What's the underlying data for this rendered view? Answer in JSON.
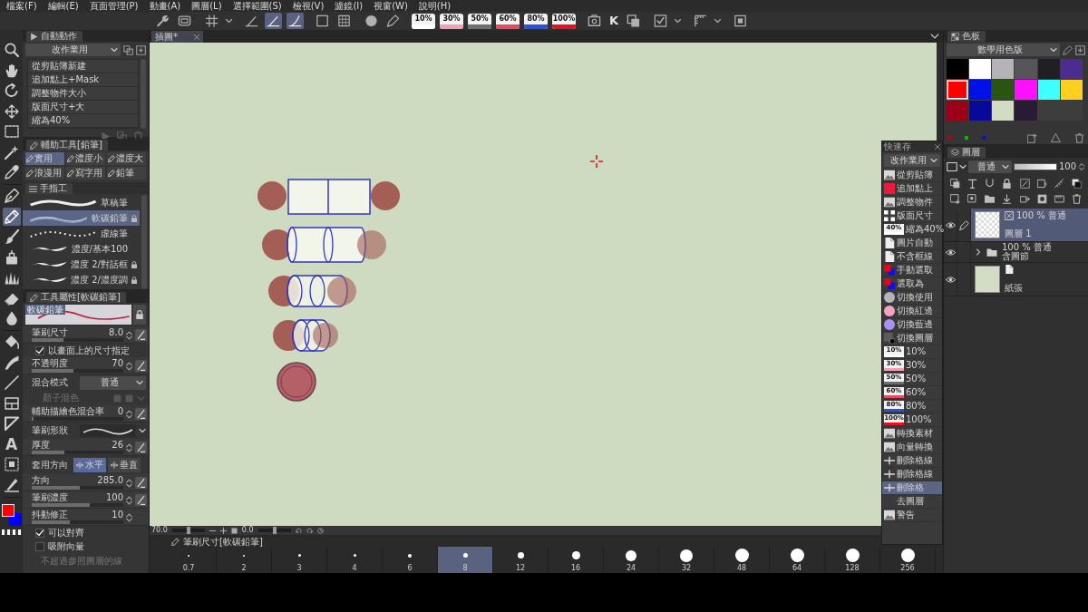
{
  "menu": [
    "檔案(F)",
    "編輯(E)",
    "頁面管理(P)",
    "動畫(A)",
    "圖層(L)",
    "選擇範圍(S)",
    "檢視(V)",
    "濾鏡(I)",
    "視窗(W)",
    "說明(H)"
  ],
  "toolbar": [
    [
      {
        "kind": "wrench",
        "selected": false
      },
      {
        "kind": "screen",
        "selected": false
      }
    ],
    [
      {
        "kind": "grid",
        "selected": false
      },
      {
        "kind": "caret",
        "selected": false
      }
    ],
    [
      {
        "kind": "ruler",
        "selected": false
      },
      {
        "kind": "ruler",
        "selected": true
      },
      {
        "kind": "curve",
        "selected": true
      }
    ],
    [
      {
        "kind": "box",
        "selected": false
      },
      {
        "kind": "gridbox",
        "selected": false
      }
    ],
    [
      {
        "kind": "dot",
        "selected": false
      },
      {
        "kind": "pen",
        "selected": false
      }
    ],
    [
      {
        "kind": "badge",
        "label": "10%",
        "color": "#ffffff",
        "selected": false
      },
      {
        "kind": "badge",
        "label": "30%",
        "color": "#f4a0b0",
        "selected": false
      },
      {
        "kind": "badge",
        "label": "50%",
        "color": "#6e6e6e",
        "selected": false
      },
      {
        "kind": "badge",
        "label": "60%",
        "color": "#e84860",
        "selected": false
      },
      {
        "kind": "badge",
        "label": "80%",
        "color": "#2850e8",
        "selected": false
      },
      {
        "kind": "badge",
        "label": "100%",
        "color": "#e81020",
        "selected": false
      }
    ],
    [
      {
        "kind": "image",
        "selected": false
      },
      {
        "kind": "letter",
        "label": "K",
        "selected": false
      },
      {
        "kind": "copy",
        "selected": false
      }
    ],
    [
      {
        "kind": "check",
        "selected": false
      },
      {
        "kind": "caret",
        "selected": false
      }
    ],
    [
      {
        "kind": "rulerset",
        "selected": false
      },
      {
        "kind": "caret",
        "selected": false
      }
    ],
    [
      {
        "kind": "square",
        "selected": false
      }
    ]
  ],
  "tools": [
    [
      {
        "kind": "zoom",
        "selected": false
      },
      {
        "kind": "hand",
        "selected": false
      },
      {
        "kind": "rotate",
        "selected": false
      },
      {
        "kind": "move",
        "selected": false
      },
      {
        "kind": "select",
        "selected": false
      },
      {
        "kind": "wand",
        "selected": false
      },
      {
        "kind": "eyedropper",
        "selected": false
      }
    ],
    [
      {
        "kind": "pen",
        "selected": false
      },
      {
        "kind": "pencil",
        "selected": true
      },
      {
        "kind": "brush",
        "selected": false
      },
      {
        "kind": "airbrush",
        "selected": false
      },
      {
        "kind": "decoration",
        "selected": false
      },
      {
        "kind": "eraser",
        "selected": false
      },
      {
        "kind": "blend",
        "selected": false
      }
    ],
    [
      {
        "kind": "fill",
        "selected": false
      },
      {
        "kind": "gradient",
        "selected": false
      },
      {
        "kind": "line",
        "selected": false
      },
      {
        "kind": "frame",
        "selected": false
      },
      {
        "kind": "ruler",
        "selected": false
      },
      {
        "kind": "text",
        "label": "A",
        "selected": false
      },
      {
        "kind": "balloon",
        "selected": false
      },
      {
        "kind": "correction",
        "selected": false
      }
    ]
  ],
  "colors": {
    "main": {
      "color": "#ff0000"
    },
    "sub": {
      "color": "#0000ff"
    }
  },
  "auto_action": {
    "tab": "自動動作",
    "set": "改作業用",
    "items": [
      "從剪貼簿新建",
      "追加點上+Mask",
      "調整物件大小",
      "版面尺寸+大",
      "縮為40%"
    ]
  },
  "sub_tool": {
    "title": "輔助工具[鉛筆]",
    "groups": [
      {
        "label": "實用",
        "selected": true
      },
      {
        "label": "濃度小",
        "selected": false
      },
      {
        "label": "濃度大",
        "selected": false
      },
      {
        "label": "浪漫用",
        "selected": false
      },
      {
        "label": "寫字用",
        "selected": false
      },
      {
        "label": "鉛筆",
        "selected": false
      }
    ],
    "tab": "手指工",
    "brushes": [
      {
        "kind": "rough",
        "label": "草稿筆",
        "selected": false,
        "locked": false
      },
      {
        "kind": "soft",
        "label": "軟碳鉛筆",
        "selected": true,
        "locked": true
      },
      {
        "kind": "dotted",
        "label": "虛線筆",
        "selected": false,
        "locked": false
      },
      {
        "kind": "stroke",
        "label": "濃度/基本100",
        "selected": false,
        "locked": false
      },
      {
        "kind": "stroke",
        "label": "濃度 2/對話框",
        "selected": false,
        "locked": true
      },
      {
        "kind": "stroke",
        "label": "濃度 2/濃度調",
        "selected": false,
        "locked": true
      }
    ]
  },
  "tool_property": {
    "title": "工具屬性[軟碳鉛筆]",
    "preview_label": "軟碳鉛筆",
    "rows": [
      {
        "kind": "slider",
        "label": "筆刷尺寸",
        "value": "8.0",
        "level": 0.35,
        "pressure": true
      },
      {
        "kind": "check",
        "label": "以畫面上的尺寸指定",
        "checked": true
      },
      {
        "kind": "slider",
        "label": "不透明度",
        "value": "70",
        "level": 0.46,
        "pressure": true
      },
      {
        "kind": "select",
        "label": "混合模式",
        "value": "普通"
      },
      {
        "kind": "disabled",
        "label": "顏子混色"
      },
      {
        "kind": "slider",
        "label": "輔助描繪色混合率",
        "value": "0",
        "level": 0,
        "pressure": true
      },
      {
        "kind": "shape",
        "label": "筆刷形狀"
      },
      {
        "kind": "slider",
        "label": "厚度",
        "value": "26",
        "level": 0.36,
        "pressure": true
      },
      {
        "kind": "toggle",
        "label": "套用方向",
        "options": [
          {
            "label": "水平",
            "selected": true
          },
          {
            "label": "垂直",
            "selected": false
          }
        ]
      },
      {
        "kind": "slider",
        "label": "方向",
        "value": "285.0",
        "level": 0.52,
        "pressure": true
      },
      {
        "kind": "slider",
        "label": "筆刷濃度",
        "value": "100",
        "level": 0.63,
        "pressure": true
      },
      {
        "kind": "slider",
        "label": "抖動修正",
        "value": "10",
        "level": 0.42,
        "pressure": false
      },
      {
        "kind": "check",
        "label": "可以對齊",
        "checked": true
      },
      {
        "kind": "check",
        "label": "吸附向量",
        "checked": false
      },
      {
        "kind": "note",
        "label": "不超過參照圖層的線"
      }
    ]
  },
  "canvas": {
    "tab": "插圖*",
    "zoom": {
      "value": "70.0",
      "level": 0.5
    },
    "angle": {
      "value": "0.0",
      "level": 0.5
    }
  },
  "quick_access": {
    "title": "快速存",
    "set": "改作業用",
    "items": [
      {
        "kind": "image",
        "label": "從剪貼簿",
        "selected": false
      },
      {
        "kind": "color",
        "label": "追加點上",
        "color": "#ee1a3a",
        "selected": false
      },
      {
        "kind": "image",
        "label": "調整物件",
        "selected": false
      },
      {
        "kind": "fit",
        "label": "版面尺寸",
        "selected": false
      },
      {
        "kind": "badge",
        "badge": "40%",
        "label": "縮為40%",
        "color": "#ffffff",
        "selected": false
      },
      {
        "kind": "page",
        "label": "圖片自動",
        "selected": false
      },
      {
        "kind": "page",
        "label": "不含框線",
        "selected": false
      },
      {
        "kind": "pair",
        "label": "手動選取",
        "selected": false
      },
      {
        "kind": "pair",
        "label": "選取為",
        "selected": false
      },
      {
        "kind": "circle",
        "label": "切換使用",
        "color": "#b4b4bc",
        "selected": false
      },
      {
        "kind": "circle",
        "label": "切換紅邊",
        "color": "#f4a4bc",
        "selected": false
      },
      {
        "kind": "circle",
        "label": "切換藍邊",
        "color": "#a890f4",
        "selected": false
      },
      {
        "kind": "layercolor",
        "label": "切換圖層",
        "selected": false
      },
      {
        "kind": "badge",
        "badge": "10%",
        "label": "10%",
        "color": "#ffffff",
        "selected": false
      },
      {
        "kind": "badge",
        "badge": "30%",
        "label": "30%",
        "color": "#f4a0b0",
        "selected": false
      },
      {
        "kind": "badge",
        "badge": "50%",
        "label": "50%",
        "color": "#6e6e6e",
        "selected": false
      },
      {
        "kind": "badge",
        "badge": "60%",
        "label": "60%",
        "color": "#e84860",
        "selected": false
      },
      {
        "kind": "badge",
        "badge": "80%",
        "label": "80%",
        "color": "#2850e8",
        "selected": false
      },
      {
        "kind": "badge",
        "badge": "100%",
        "label": "100%",
        "color": "#e81020",
        "selected": false
      },
      {
        "kind": "image",
        "label": "轉換素材",
        "selected": false
      },
      {
        "kind": "image",
        "label": "向量轉換",
        "selected": false
      },
      {
        "kind": "rule",
        "label": "刪除格線",
        "selected": false
      },
      {
        "kind": "rule",
        "label": "刪除格線",
        "selected": false
      },
      {
        "kind": "rule",
        "label": "刪除格",
        "selected": true
      },
      {
        "kind": "none",
        "label": "去圖層",
        "selected": false
      },
      {
        "kind": "image",
        "label": "警告",
        "selected": false
      }
    ]
  },
  "brush_size": {
    "title": "筆刷尺寸[軟碳鉛筆]",
    "sizes": [
      {
        "label": "0.7",
        "selected": false
      },
      {
        "label": "2",
        "selected": false
      },
      {
        "label": "3",
        "selected": false
      },
      {
        "label": "4",
        "selected": false
      },
      {
        "label": "6",
        "selected": false
      },
      {
        "label": "8",
        "selected": true
      },
      {
        "label": "12",
        "selected": false
      },
      {
        "label": "16",
        "selected": false
      },
      {
        "label": "24",
        "selected": false
      },
      {
        "label": "32",
        "selected": false
      },
      {
        "label": "48",
        "selected": false
      },
      {
        "label": "64",
        "selected": false
      },
      {
        "label": "128",
        "selected": false
      },
      {
        "label": "256",
        "selected": false
      }
    ]
  },
  "color_set": {
    "tab": "色板",
    "set": "數學用色版",
    "swatches": [
      {
        "color": "#000000",
        "selected": false
      },
      {
        "color": "#ffffff",
        "selected": false
      },
      {
        "color": "#b4b4b8",
        "selected": false
      },
      {
        "color": "#56565a",
        "selected": false
      },
      {
        "color": "#202024",
        "selected": false
      },
      {
        "color": "#4c2c8c",
        "selected": false
      },
      {
        "color": "#ff0000",
        "selected": true
      },
      {
        "color": "#0010e8",
        "selected": false
      },
      {
        "color": "#2a5412",
        "selected": false
      },
      {
        "color": "#ff10ff",
        "selected": false
      },
      {
        "color": "#40ffff",
        "selected": false
      },
      {
        "color": "#ffd020",
        "selected": false
      },
      {
        "color": "#9a0018",
        "selected": false
      },
      {
        "color": "#08089a",
        "selected": false
      },
      {
        "color": "#d2dcc4",
        "selected": false
      },
      {
        "color": "#281c34",
        "selected": false
      }
    ],
    "dots": [
      {
        "color": "#c00000"
      },
      {
        "color": "#10b010"
      },
      {
        "color": "#1010c0"
      }
    ]
  },
  "layer_panel": {
    "tab": "圖層",
    "blend": "普通",
    "opacity": {
      "value": "100",
      "level": 1
    },
    "layers": [
      {
        "kind": "raster",
        "visible": true,
        "editing": true,
        "selected": true,
        "mode": "100 % 普通",
        "name": "圖層 1"
      },
      {
        "kind": "folder",
        "visible": true,
        "editing": false,
        "selected": false,
        "expanded": false,
        "mode": "100 % 普通",
        "name": "含圖節"
      },
      {
        "kind": "paper",
        "visible": true,
        "editing": false,
        "selected": false,
        "name": "紙張"
      }
    ]
  }
}
